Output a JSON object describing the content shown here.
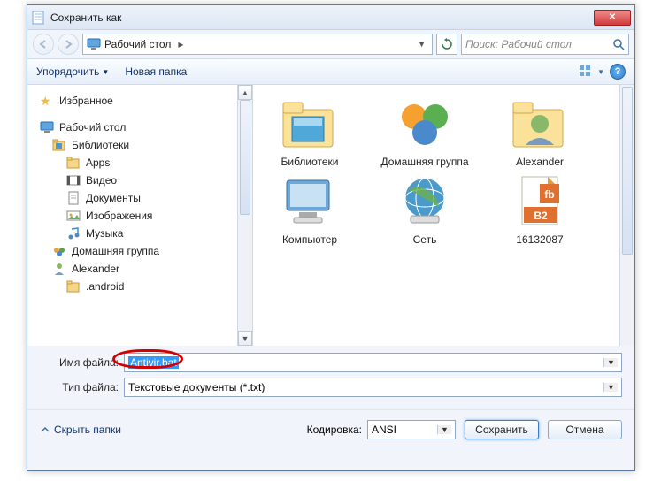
{
  "window_title": "Сохранить как",
  "address": {
    "location": "Рабочий стол",
    "arrow": "▸"
  },
  "search": {
    "placeholder": "Поиск: Рабочий стол"
  },
  "toolbar": {
    "organize": "Упорядочить",
    "new_folder": "Новая папка"
  },
  "sidebar": {
    "favorites": "Избранное",
    "desktop": "Рабочий стол",
    "libraries": "Библиотеки",
    "apps": "Apps",
    "video": "Видео",
    "documents": "Документы",
    "images": "Изображения",
    "music": "Музыка",
    "homegroup": "Домашняя группа",
    "alexander": "Alexander",
    "android": ".android"
  },
  "items": {
    "libraries": "Библиотеки",
    "homegroup": "Домашняя группа",
    "alexander": "Alexander",
    "computer": "Компьютер",
    "network": "Сеть",
    "file1": "16132087"
  },
  "form": {
    "filename_label": "Имя файла:",
    "filename_value": "Antivir.bat",
    "filetype_label": "Тип файла:",
    "filetype_value": "Текстовые документы (*.txt)"
  },
  "footer": {
    "hide": "Скрыть папки",
    "encoding_label": "Кодировка:",
    "encoding_value": "ANSI",
    "save": "Сохранить",
    "cancel": "Отмена"
  }
}
